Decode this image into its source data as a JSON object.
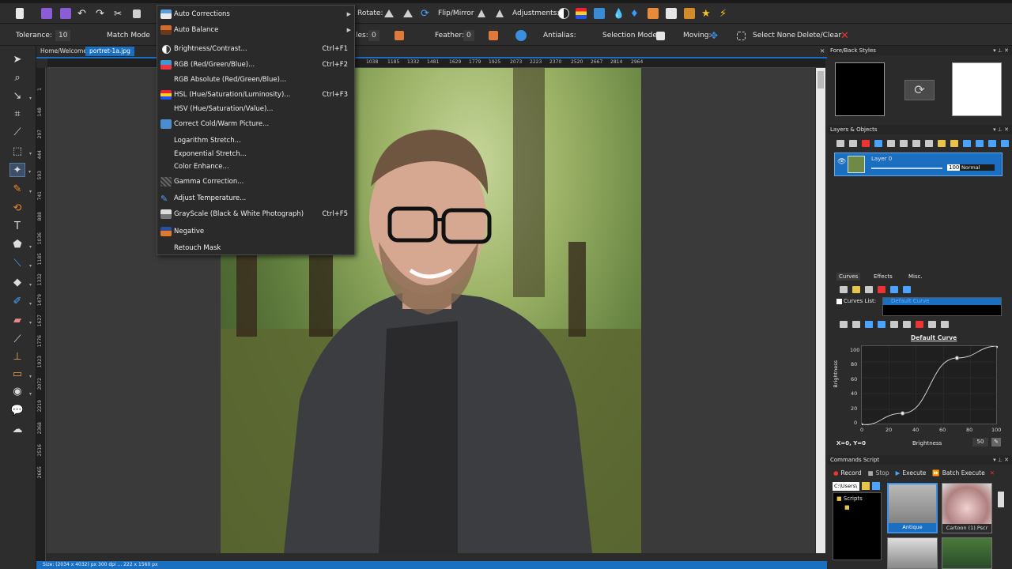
{
  "toolbar_top": {
    "rotate_label": "Rotate:",
    "flip_label": "Flip/Mirror",
    "adjustments_label": "Adjustments:"
  },
  "toolbar_options": {
    "tolerance_label": "Tolerance:",
    "tolerance_value": "10",
    "match_mode_label": "Match Mode",
    "sides_label_partial": "les:",
    "sides_value": "0",
    "feather_label": "Feather:",
    "feather_value": "0",
    "antialias_label": "Antialias:",
    "selection_mode_label": "Selection Mode:",
    "moving_label": "Moving:",
    "select_none_label": "Select None",
    "delete_clear_label": "Delete/Clear"
  },
  "document_tabs": [
    {
      "label": "Home/Welcome",
      "active": false
    },
    {
      "label": "portret-1a.jpg",
      "active": true
    }
  ],
  "ruler_h_ticks": [
    "1038",
    "1185",
    "1332",
    "1481",
    "1629",
    "1779",
    "1925",
    "2073",
    "2223",
    "2370",
    "2520",
    "2667",
    "2814",
    "2964"
  ],
  "ruler_v_ticks": [
    "1",
    "148",
    "297",
    "444",
    "593",
    "741",
    "888",
    "1036",
    "1185",
    "1332",
    "1479",
    "1627",
    "1776",
    "1923",
    "2072",
    "2219",
    "2368",
    "2516",
    "2665"
  ],
  "adjust_menu": {
    "items": [
      {
        "label": "Auto Corrections",
        "shortcut": "",
        "submenu": true,
        "icon": "auto-corrections-icon"
      },
      {
        "label": "Auto Balance",
        "shortcut": "",
        "submenu": true,
        "icon": "auto-balance-icon"
      },
      {
        "label": "Brightness/Contrast...",
        "shortcut": "Ctrl+F1",
        "submenu": false,
        "icon": "brightness-icon"
      },
      {
        "label": "RGB (Red/Green/Blue)...",
        "shortcut": "Ctrl+F2",
        "submenu": false,
        "icon": "rgb-icon"
      },
      {
        "label": "RGB Absolute (Red/Green/Blue)...",
        "shortcut": "",
        "submenu": false,
        "icon": ""
      },
      {
        "label": "HSL (Hue/Saturation/Luminosity)...",
        "shortcut": "Ctrl+F3",
        "submenu": false,
        "icon": "hsl-icon"
      },
      {
        "label": "HSV (Hue/Saturation/Value)...",
        "shortcut": "",
        "submenu": false,
        "icon": ""
      },
      {
        "label": "Correct Cold/Warm Picture...",
        "shortcut": "",
        "submenu": false,
        "icon": "cold-warm-icon"
      },
      {
        "label": "Logarithm Stretch...",
        "shortcut": "",
        "submenu": false,
        "icon": ""
      },
      {
        "label": "Exponential Stretch...",
        "shortcut": "",
        "submenu": false,
        "icon": ""
      },
      {
        "label": "Color Enhance...",
        "shortcut": "",
        "submenu": false,
        "icon": ""
      },
      {
        "label": "Gamma Correction...",
        "shortcut": "",
        "submenu": false,
        "icon": "gamma-icon"
      },
      {
        "label": "Adjust Temperature...",
        "shortcut": "",
        "submenu": false,
        "icon": "temperature-icon"
      },
      {
        "label": "GrayScale (Black & White Photograph)",
        "shortcut": "Ctrl+F5",
        "submenu": false,
        "icon": "grayscale-icon"
      },
      {
        "label": "Negative",
        "shortcut": "",
        "submenu": false,
        "icon": "negative-icon"
      },
      {
        "label": "Retouch Mask",
        "shortcut": "",
        "submenu": false,
        "icon": ""
      }
    ]
  },
  "fore_back_panel": {
    "title": "Fore/Back Styles",
    "fore_color": "#000000",
    "back_color": "#ffffff"
  },
  "layers_panel": {
    "title": "Layers & Objects",
    "layer_name": "Layer 0",
    "opacity": "100",
    "blend_mode": "Normal"
  },
  "curves_panel": {
    "tabs": [
      "Curves",
      "Effects",
      "Misc."
    ],
    "curves_list_label": "Curves List:",
    "selected_curve": "Default Curve",
    "chart_title": "Default Curve",
    "ylabel": "Brightness",
    "xlabel": "Brightness",
    "y_ticks": [
      "100",
      "80",
      "60",
      "40",
      "20",
      "0"
    ],
    "x_ticks": [
      "0",
      "20",
      "40",
      "60",
      "80",
      "100"
    ],
    "coord_readout": "X=0, Y=0",
    "value_field": "50"
  },
  "chart_data": {
    "type": "line",
    "title": "Default Curve",
    "xlabel": "Brightness",
    "ylabel": "Brightness",
    "xlim": [
      0,
      100
    ],
    "ylim": [
      0,
      100
    ],
    "series": [
      {
        "x": [
          0,
          30,
          70,
          100
        ],
        "y": [
          0,
          15,
          85,
          100
        ]
      }
    ]
  },
  "commands_panel": {
    "title": "Commands Script",
    "record_label": "Record",
    "stop_label": "Stop",
    "execute_label": "Execute",
    "batch_execute_label": "Batch Execute",
    "path_value": "C:\\Users\\",
    "folder_label": "Scripts",
    "thumbnails": [
      {
        "label": "Antique",
        "selected": true
      },
      {
        "label": "Cartoon (1).Pscr",
        "selected": false
      }
    ]
  },
  "status_text": "Size: (2034 x 4032) px  300 dpi    ...  222 x 1560 px"
}
